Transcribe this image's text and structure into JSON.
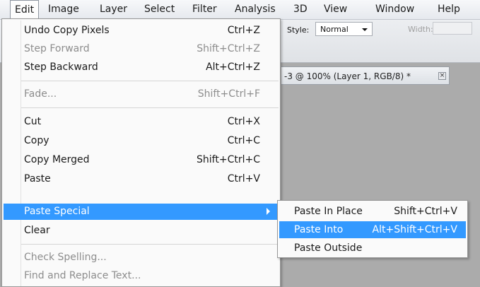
{
  "menubar": {
    "items": [
      "Edit",
      "Image",
      "Layer",
      "Select",
      "Filter",
      "Analysis",
      "3D",
      "View",
      "Window",
      "Help"
    ],
    "active": "Edit"
  },
  "options": {
    "style_label": "Style:",
    "style_value": "Normal",
    "width_label": "Width:"
  },
  "doc_tab": {
    "title": "-3 @ 100% (Layer 1, RGB/8) *",
    "close_glyph": "×"
  },
  "edit_menu": {
    "items": [
      {
        "label": "Undo Copy Pixels",
        "shortcut": "Ctrl+Z",
        "state": "normal"
      },
      {
        "label": "Step Forward",
        "shortcut": "Shift+Ctrl+Z",
        "state": "disabled"
      },
      {
        "label": "Step Backward",
        "shortcut": "Alt+Ctrl+Z",
        "state": "normal"
      },
      {
        "label": "Fade...",
        "shortcut": "Shift+Ctrl+F",
        "state": "disabled"
      },
      {
        "label": "Cut",
        "shortcut": "Ctrl+X",
        "state": "normal"
      },
      {
        "label": "Copy",
        "shortcut": "Ctrl+C",
        "state": "normal"
      },
      {
        "label": "Copy Merged",
        "shortcut": "Shift+Ctrl+C",
        "state": "normal"
      },
      {
        "label": "Paste",
        "shortcut": "Ctrl+V",
        "state": "normal"
      },
      {
        "label": "Paste Special",
        "shortcut": "",
        "state": "highlighted"
      },
      {
        "label": "Clear",
        "shortcut": "",
        "state": "normal"
      },
      {
        "label": "Check Spelling...",
        "shortcut": "",
        "state": "disabled"
      },
      {
        "label": "Find and Replace Text...",
        "shortcut": "",
        "state": "disabled"
      }
    ]
  },
  "paste_special_submenu": {
    "items": [
      {
        "label": "Paste In Place",
        "shortcut": "Shift+Ctrl+V",
        "state": "normal"
      },
      {
        "label": "Paste Into",
        "shortcut": "Alt+Shift+Ctrl+V",
        "state": "highlighted"
      },
      {
        "label": "Paste Outside",
        "shortcut": "",
        "state": "normal"
      }
    ]
  },
  "colors": {
    "highlight": "#3399ff",
    "workspace": "#ababab",
    "disabled_text": "#8d8d8d"
  }
}
